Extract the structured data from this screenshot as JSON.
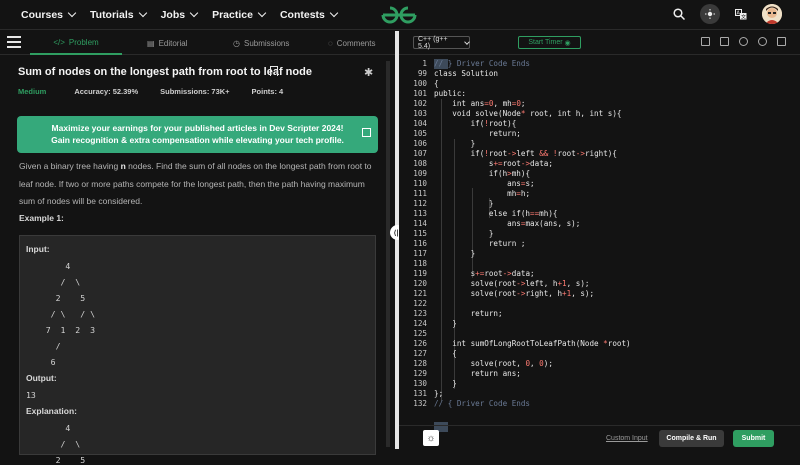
{
  "nav": {
    "items": [
      "Courses",
      "Tutorials",
      "Jobs",
      "Practice",
      "Contests"
    ],
    "icons": {
      "search": "search-icon",
      "theme": "sun-icon",
      "translate": "translate-icon",
      "avatar": "avatar"
    }
  },
  "problem": {
    "tabs": [
      {
        "label": "Problem",
        "icon": "</>"
      },
      {
        "label": "Editorial",
        "icon": "▤"
      },
      {
        "label": "Submissions",
        "icon": "◷"
      },
      {
        "label": "Comments",
        "icon": "◌"
      }
    ],
    "title": "Sum of nodes on the longest path from root to leaf node",
    "difficulty": "Medium",
    "accuracy": "Accuracy: 52.39%",
    "submissions": "Submissions: 73K+",
    "points": "Points: 4",
    "promo": "Maximize your earnings for your published articles in Dev Scripter 2024! Gain recognition & extra compensation while elevating your tech profile.",
    "description_a": "Given a binary tree having ",
    "description_n": "n",
    "description_b": " nodes. Find the sum of all nodes on the longest path from root to leaf node. If two or more paths compete for the longest path, then the path having maximum sum of nodes will be considered.",
    "example_title": "Example 1:",
    "example": {
      "input_label": "Input:",
      "tree": [
        "        4",
        "       /  \\",
        "      2    5",
        "     / \\   / \\",
        "    7  1  2  3",
        "      /",
        "     6"
      ],
      "output_label": "Output:",
      "output": "13",
      "explanation_label": "Explanation:",
      "explanation_tree": [
        "        4",
        "       /  \\",
        "      2    5"
      ]
    }
  },
  "editor": {
    "language": "C++ (g++ 5.4)",
    "timer": "Start Timer",
    "line_numbers": [
      "1",
      "99",
      "100",
      "101",
      "102",
      "103",
      "104",
      "105",
      "106",
      "107",
      "108",
      "109",
      "110",
      "111",
      "112",
      "113",
      "114",
      "115",
      "116",
      "117",
      "118",
      "119",
      "120",
      "121",
      "122",
      "123",
      "124",
      "125",
      "126",
      "127",
      "128",
      "129",
      "130",
      "131",
      "132"
    ],
    "custom_input": "Custom Input",
    "compile_run": "Compile & Run",
    "submit": "Submit"
  }
}
